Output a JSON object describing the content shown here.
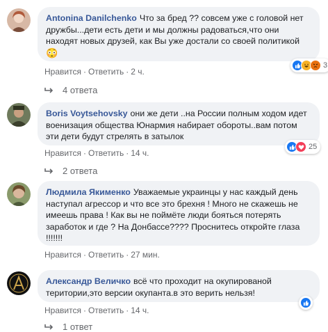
{
  "comments": [
    {
      "author": "Antonina Danilchenko",
      "text": "Что за бред ?? совсем уже с головой нет дружбы...дети есть дети и мы должны радоваться,что они находят новых друзей, как Вы уже достали со своей политикой",
      "emoji": "😳",
      "reactions": [
        "like-icon",
        "haha-icon",
        "angry-icon"
      ],
      "reaction_count": "3",
      "like_label": "Нравится",
      "reply_label": "Ответить",
      "time": "2 ч.",
      "replies": "4 ответа"
    },
    {
      "author": "Boris Voytsehovsky",
      "text": "они же дети ..на России полным ходом идет военизация общества Юнармия набирает обороты..вам потом эти дети будут стрелять в затылок",
      "reactions": [
        "like-icon",
        "love-icon"
      ],
      "reaction_count": "25",
      "like_label": "Нравится",
      "reply_label": "Ответить",
      "time": "14 ч.",
      "replies": "2 ответа"
    },
    {
      "author": "Людмила Якименко",
      "text": "Уважаемые украинцы у нас каждый день наступал агрессор и что все это брехня ! Много не скажешь не имеешь права ! Как вы не поймёте люди бояться потерять заработок и где ? На Донбассе???? Проснитесь откройте глаза !!!!!!!",
      "like_label": "Нравится",
      "reply_label": "Ответить",
      "time": "27 мин."
    },
    {
      "author": "Александр Величко",
      "text": "всё что проходит на окупированой територии,это версии окупанта.в это верить нельзя!",
      "reactions": [
        "like-icon"
      ],
      "like_label": "Нравится",
      "reply_label": "Ответить",
      "time": "14 ч.",
      "replies": "1 ответ"
    }
  ],
  "colors": {
    "author": "#385898",
    "bubble": "#f0f2f5",
    "meta": "#65676b",
    "like": "#1877f2",
    "love": "#f33e58",
    "haha": "#f7b125",
    "angry": "#e9710f"
  }
}
